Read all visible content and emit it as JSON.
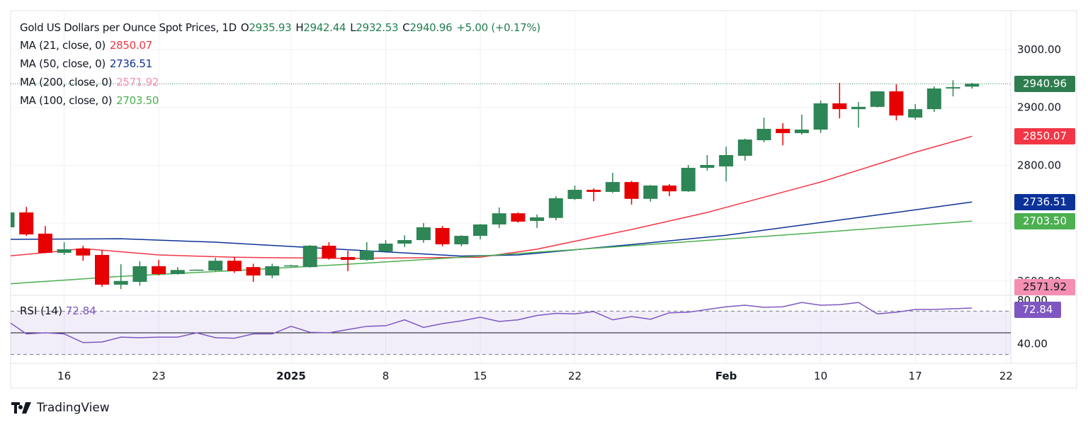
{
  "header": {
    "symbol": "Gold US Dollars per Ounce Spot Prices, 1D",
    "o_label": "O",
    "o": "2935.93",
    "h_label": "H",
    "h": "2942.44",
    "l_label": "L",
    "l": "2932.53",
    "c_label": "C",
    "c": "2940.96",
    "change": "+5.00 (+0.17%)"
  },
  "indicators": [
    {
      "label": "MA (21, close, 0)",
      "value": "2850.07",
      "color": "#f23645"
    },
    {
      "label": "MA (50, close, 0)",
      "value": "2736.51",
      "color": "#0c3299"
    },
    {
      "label": "MA (200, close, 0)",
      "value": "2571.92",
      "color": "#f48fb1"
    },
    {
      "label": "MA (100, close, 0)",
      "value": "2703.50",
      "color": "#4caf50"
    }
  ],
  "rsi": {
    "label": "RSI (14)",
    "value": "72.84",
    "color": "#7e57c2"
  },
  "price_tag": {
    "value": "2940.96",
    "color": "#2e7d4f"
  },
  "brand": "TradingView",
  "chart_data": {
    "type": "candlestick",
    "up_color": "#2e8555",
    "down_color": "#e60000",
    "ylim": [
      2570,
      3050
    ],
    "y_ticks": [
      "3000.00",
      "2900.00",
      "2800.00",
      "2700.00",
      "2600.00"
    ],
    "x_ticks": [
      {
        "label": "16",
        "date": "2024-12-16"
      },
      {
        "label": "23",
        "date": "2024-12-23"
      },
      {
        "label": "2025",
        "date": "2025-01-01",
        "bold": true
      },
      {
        "label": "8",
        "date": "2025-01-08"
      },
      {
        "label": "15",
        "date": "2025-01-15"
      },
      {
        "label": "22",
        "date": "2025-01-22"
      },
      {
        "label": "Feb",
        "date": "2025-02-03",
        "bold": true
      },
      {
        "label": "10",
        "date": "2025-02-10"
      },
      {
        "label": "17",
        "date": "2025-02-17"
      },
      {
        "label": "22",
        "date": "2025-02-22"
      }
    ],
    "candles": [
      {
        "d": "2024-12-11",
        "o": 2692.8,
        "h": 2720,
        "l": 2690,
        "c": 2718.5
      },
      {
        "d": "2024-12-12",
        "o": 2718.5,
        "h": 2728,
        "l": 2678,
        "c": 2680.5
      },
      {
        "d": "2024-12-13",
        "o": 2681.8,
        "h": 2695,
        "l": 2648,
        "c": 2648.7
      },
      {
        "d": "2024-12-16",
        "o": 2648.7,
        "h": 2667,
        "l": 2645,
        "c": 2654.8
      },
      {
        "d": "2024-12-17",
        "o": 2656,
        "h": 2661,
        "l": 2635,
        "c": 2644
      },
      {
        "d": "2024-12-18",
        "o": 2645,
        "h": 2653.6,
        "l": 2590,
        "c": 2593.6
      },
      {
        "d": "2024-12-19",
        "o": 2593.6,
        "h": 2629,
        "l": 2586,
        "c": 2600
      },
      {
        "d": "2024-12-20",
        "o": 2598.5,
        "h": 2634,
        "l": 2592,
        "c": 2625.5
      },
      {
        "d": "2024-12-23",
        "o": 2625.5,
        "h": 2636.5,
        "l": 2609.5,
        "c": 2612
      },
      {
        "d": "2024-12-24",
        "o": 2612,
        "h": 2624,
        "l": 2611,
        "c": 2619
      },
      {
        "d": "2024-12-25",
        "o": 2619,
        "h": 2620,
        "l": 2618,
        "c": 2619.5
      },
      {
        "d": "2024-12-26",
        "o": 2618,
        "h": 2640,
        "l": 2617,
        "c": 2635
      },
      {
        "d": "2024-12-27",
        "o": 2635,
        "h": 2641.5,
        "l": 2614,
        "c": 2617
      },
      {
        "d": "2024-12-30",
        "o": 2624,
        "h": 2630,
        "l": 2598.5,
        "c": 2609.5
      },
      {
        "d": "2024-12-31",
        "o": 2609.5,
        "h": 2630,
        "l": 2604.7,
        "c": 2625.5
      },
      {
        "d": "2025-01-01",
        "o": 2626,
        "h": 2628,
        "l": 2625,
        "c": 2627
      },
      {
        "d": "2025-01-02",
        "o": 2624,
        "h": 2662,
        "l": 2623,
        "c": 2661
      },
      {
        "d": "2025-01-03",
        "o": 2661,
        "h": 2667,
        "l": 2637,
        "c": 2639
      },
      {
        "d": "2025-01-06",
        "o": 2641.4,
        "h": 2652.4,
        "l": 2617,
        "c": 2636.5
      },
      {
        "d": "2025-01-07",
        "o": 2636.5,
        "h": 2667,
        "l": 2635,
        "c": 2652.4
      },
      {
        "d": "2025-01-08",
        "o": 2651,
        "h": 2670.7,
        "l": 2648.7,
        "c": 2664.6
      },
      {
        "d": "2025-01-09",
        "o": 2664.6,
        "h": 2679,
        "l": 2658.5,
        "c": 2670.7
      },
      {
        "d": "2025-01-10",
        "o": 2670.7,
        "h": 2700,
        "l": 2666,
        "c": 2692.8
      },
      {
        "d": "2025-01-13",
        "o": 2691.6,
        "h": 2695,
        "l": 2660,
        "c": 2663.4
      },
      {
        "d": "2025-01-14",
        "o": 2663.4,
        "h": 2679,
        "l": 2660,
        "c": 2678
      },
      {
        "d": "2025-01-15",
        "o": 2678,
        "h": 2698.5,
        "l": 2672,
        "c": 2697.7
      },
      {
        "d": "2025-01-16",
        "o": 2697.7,
        "h": 2727,
        "l": 2691.6,
        "c": 2717
      },
      {
        "d": "2025-01-17",
        "o": 2717,
        "h": 2718.5,
        "l": 2701,
        "c": 2702.6
      },
      {
        "d": "2025-01-20",
        "o": 2703.8,
        "h": 2715,
        "l": 2691.6,
        "c": 2710
      },
      {
        "d": "2025-01-21",
        "o": 2709,
        "h": 2746.6,
        "l": 2705,
        "c": 2743
      },
      {
        "d": "2025-01-22",
        "o": 2741.7,
        "h": 2765,
        "l": 2740,
        "c": 2757.6
      },
      {
        "d": "2025-01-23",
        "o": 2757.6,
        "h": 2760,
        "l": 2738,
        "c": 2754
      },
      {
        "d": "2025-01-24",
        "o": 2754,
        "h": 2787,
        "l": 2752,
        "c": 2771
      },
      {
        "d": "2025-01-27",
        "o": 2771,
        "h": 2773,
        "l": 2732,
        "c": 2742
      },
      {
        "d": "2025-01-28",
        "o": 2742,
        "h": 2766,
        "l": 2737,
        "c": 2765
      },
      {
        "d": "2025-01-29",
        "o": 2765,
        "h": 2767.5,
        "l": 2746.6,
        "c": 2755
      },
      {
        "d": "2025-01-30",
        "o": 2755,
        "h": 2800.5,
        "l": 2754,
        "c": 2795.6
      },
      {
        "d": "2025-01-31",
        "o": 2795.6,
        "h": 2817.6,
        "l": 2790.7,
        "c": 2800.5
      },
      {
        "d": "2025-02-03",
        "o": 2798,
        "h": 2832,
        "l": 2772,
        "c": 2817.6
      },
      {
        "d": "2025-02-04",
        "o": 2816.4,
        "h": 2846,
        "l": 2808,
        "c": 2844.5
      },
      {
        "d": "2025-02-05",
        "o": 2843.3,
        "h": 2882.5,
        "l": 2839.6,
        "c": 2863
      },
      {
        "d": "2025-02-06",
        "o": 2863,
        "h": 2872.7,
        "l": 2834.8,
        "c": 2855.6
      },
      {
        "d": "2025-02-07",
        "o": 2855.6,
        "h": 2887.4,
        "l": 2853,
        "c": 2861.7
      },
      {
        "d": "2025-02-10",
        "o": 2861.7,
        "h": 2912,
        "l": 2855.6,
        "c": 2907
      },
      {
        "d": "2025-02-11",
        "o": 2907,
        "h": 2942.5,
        "l": 2881,
        "c": 2897
      },
      {
        "d": "2025-02-12",
        "o": 2897,
        "h": 2909.4,
        "l": 2865,
        "c": 2901
      },
      {
        "d": "2025-02-13",
        "o": 2901,
        "h": 2928,
        "l": 2900,
        "c": 2927.8
      },
      {
        "d": "2025-02-14",
        "o": 2927.8,
        "h": 2940,
        "l": 2877.6,
        "c": 2886
      },
      {
        "d": "2025-02-17",
        "o": 2882.5,
        "h": 2905.7,
        "l": 2878.8,
        "c": 2897
      },
      {
        "d": "2025-02-18",
        "o": 2897,
        "h": 2936.4,
        "l": 2892.3,
        "c": 2932.7
      },
      {
        "d": "2025-02-19",
        "o": 2932.7,
        "h": 2947,
        "l": 2919,
        "c": 2935
      },
      {
        "d": "2025-02-20",
        "o": 2935.93,
        "h": 2942.44,
        "l": 2932.53,
        "c": 2940.96
      }
    ],
    "moving_averages": [
      {
        "name": "MA (21, close, 0)",
        "color": "#f23645",
        "points": [
          [
            "2024-12-11",
            2643
          ],
          [
            "2024-12-13",
            2649
          ],
          [
            "2024-12-17",
            2656
          ],
          [
            "2024-12-23",
            2645
          ],
          [
            "2024-12-27",
            2641
          ],
          [
            "2025-01-06",
            2639
          ],
          [
            "2025-01-15",
            2641
          ],
          [
            "2025-01-20",
            2655
          ],
          [
            "2025-01-27",
            2689
          ],
          [
            "2025-01-31",
            2718.5
          ],
          [
            "2025-02-10",
            2771
          ],
          [
            "2025-02-17",
            2822.5
          ],
          [
            "2025-02-20",
            2850.07
          ]
        ]
      },
      {
        "name": "MA (50, close, 0)",
        "color": "#0c3299",
        "points": [
          [
            "2024-12-11",
            2672
          ],
          [
            "2024-12-19",
            2673
          ],
          [
            "2024-12-26",
            2667
          ],
          [
            "2025-01-06",
            2654
          ],
          [
            "2025-01-14",
            2643
          ],
          [
            "2025-01-17",
            2645
          ],
          [
            "2025-01-27",
            2663
          ],
          [
            "2025-02-03",
            2679
          ],
          [
            "2025-02-14",
            2718.5
          ],
          [
            "2025-02-20",
            2736.51
          ]
        ]
      },
      {
        "name": "MA (100, close, 0)",
        "color": "#4caf50",
        "points": [
          [
            "2024-12-11",
            2595
          ],
          [
            "2024-12-19",
            2608
          ],
          [
            "2024-12-27",
            2618
          ],
          [
            "2025-01-06",
            2629
          ],
          [
            "2025-01-15",
            2643
          ],
          [
            "2025-01-27",
            2661
          ],
          [
            "2025-02-10",
            2684
          ],
          [
            "2025-02-20",
            2703.5
          ]
        ]
      }
    ],
    "rsi_series": {
      "ylim": [
        20,
        85
      ],
      "levels": [
        70,
        50,
        30
      ],
      "y_ticks": [
        "80.00",
        "40.00"
      ],
      "values": [
        59,
        49,
        50,
        49,
        41,
        41.5,
        46,
        45.5,
        46,
        46,
        50,
        45.5,
        45,
        49,
        49,
        56,
        50.5,
        50,
        53,
        56,
        56.5,
        62,
        55,
        58.5,
        61,
        64.4,
        60.5,
        62,
        66,
        68,
        67.5,
        69.6,
        62,
        65,
        62.5,
        68.5,
        69,
        71.6,
        74,
        75.5,
        73.5,
        74,
        78,
        75.5,
        76,
        78,
        67.5,
        69,
        71.6,
        71.6,
        72.2,
        72.84
      ]
    },
    "axis_tags": [
      {
        "value": "2940.96",
        "price": 2940.96,
        "color": "#2e7d4f",
        "text": "#ffffff"
      },
      {
        "value": "2850.07",
        "price": 2850.07,
        "color": "#f23645",
        "text": "#ffffff"
      },
      {
        "value": "2736.51",
        "price": 2736.51,
        "color": "#0c3299",
        "text": "#ffffff"
      },
      {
        "value": "2703.50",
        "price": 2703.5,
        "color": "#4caf50",
        "text": "#ffffff"
      },
      {
        "value": "2571.92",
        "price": 2571.92,
        "color": "#f48fb1",
        "text": "#131722"
      }
    ]
  }
}
